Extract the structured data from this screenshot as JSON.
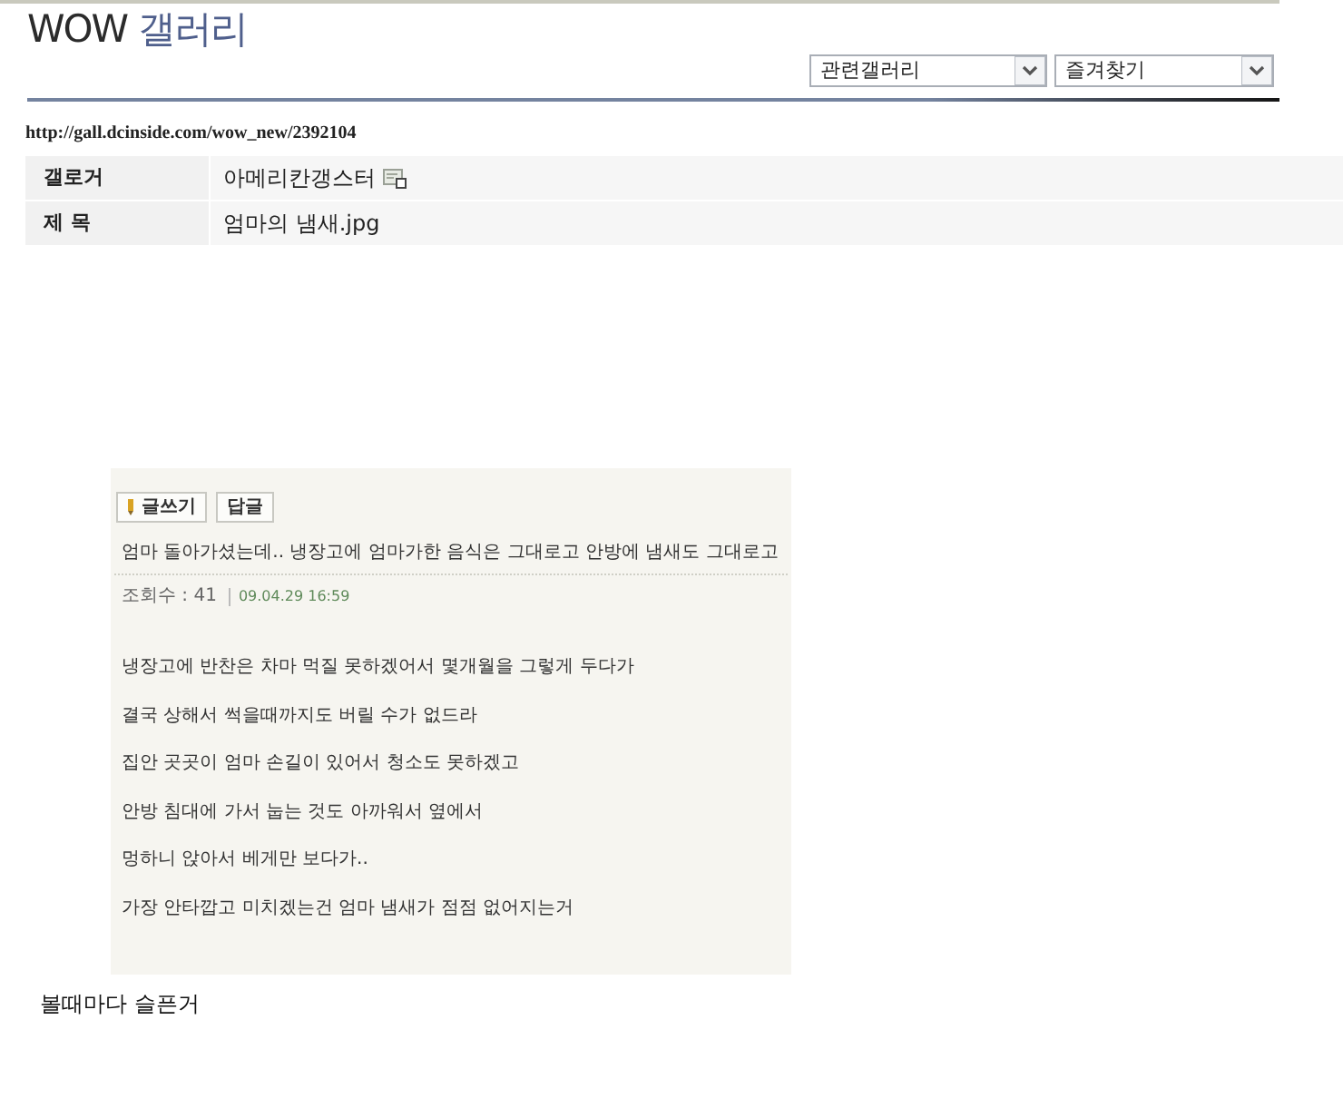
{
  "header": {
    "title": [
      {
        "text": "WOW",
        "kind": "site"
      },
      {
        "text": "갤러리",
        "kind": "section"
      }
    ],
    "dropdowns": [
      {
        "value": "관련갤러리"
      },
      {
        "value": "즐겨찾기"
      }
    ]
  },
  "url": "http://gall.dcinside.com/wow_new/2392104",
  "info_rows": [
    {
      "label": "갤로거",
      "value": "아메리칸갱스터",
      "kind": "user"
    },
    {
      "label": "제 목",
      "value": "엄마의 냄새.jpg",
      "kind": "text"
    }
  ],
  "embedded_post": {
    "buttons": [
      {
        "label": "글쓰기",
        "kind": "write"
      },
      {
        "label": "답글",
        "kind": "plain"
      }
    ],
    "title": "엄마 돌아가셨는데.. 냉장고에 엄마가한 음식은 그대로고 안방에 냄새도 그대로고",
    "views": "조회수 : 41",
    "date": "09.04.29 16:59",
    "body": [
      "냉장고에 반찬은 차마 먹질 못하겠어서 몇개월을 그렇게 두다가",
      "결국 상해서 썩을때까지도 버릴 수가 없드라",
      "집안 곳곳이 엄마 손길이 있어서 청소도 못하겠고",
      "안방 침대에 가서 눕는 것도 아까워서 옆에서",
      "멍하니 앉아서 베게만 보다가..",
      "가장 안타깝고 미치겠는건 엄마 냄새가 점점 없어지는거"
    ]
  },
  "caption": "볼때마다 슬픈거"
}
